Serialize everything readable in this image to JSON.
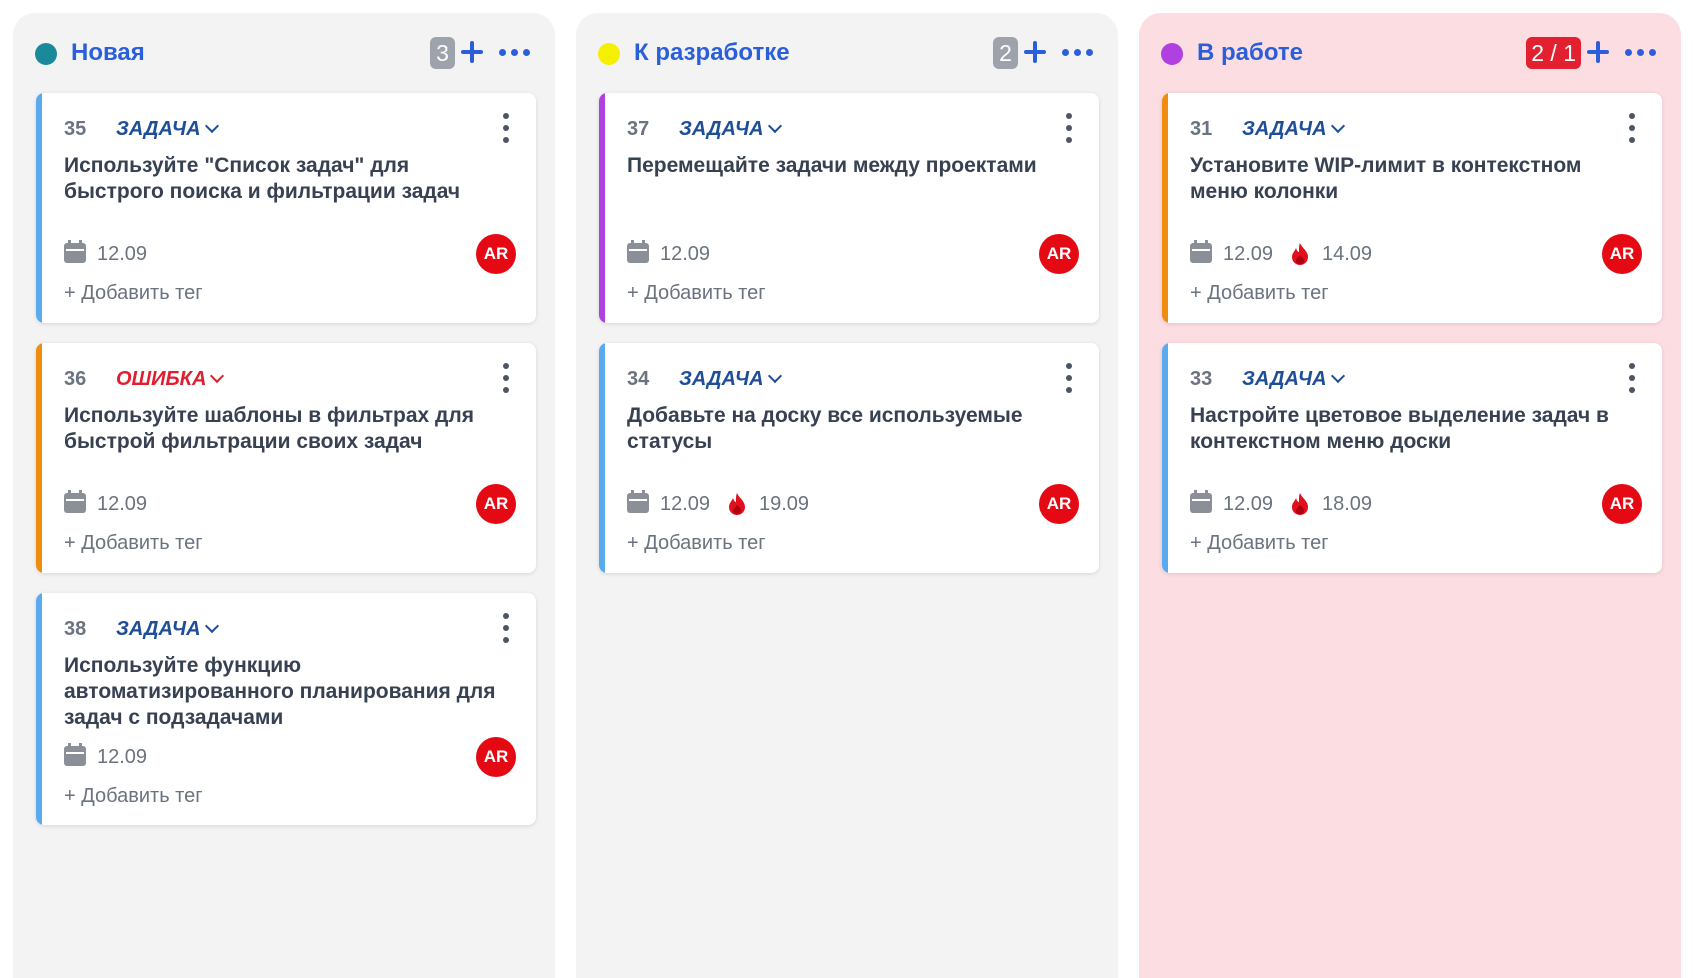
{
  "columns": [
    {
      "title": "Новая",
      "dot_color": "#1a8a9a",
      "count": "3",
      "count_over_limit": false,
      "cards": [
        {
          "number": "35",
          "type": "ЗАДАЧА",
          "type_color": "#1f4e99",
          "stripe_color": "#5aaaf0",
          "title": "Используйте \"Список задач\" для быстрого поиска и фильтрации задач",
          "date": "12.09",
          "deadline": null,
          "assignee": "AR",
          "add_tag": "+ Добавить тег"
        },
        {
          "number": "36",
          "type": "ОШИБКА",
          "type_color": "#e01e2d",
          "stripe_color": "#f08c10",
          "title": "Используйте шаблоны в фильтрах для быстрой фильтрации своих задач",
          "date": "12.09",
          "deadline": null,
          "assignee": "AR",
          "add_tag": "+ Добавить тег"
        },
        {
          "number": "38",
          "type": "ЗАДАЧА",
          "type_color": "#1f4e99",
          "stripe_color": "#5aaaf0",
          "title": "Используйте функцию автоматизированного планирования для задач с подзадачами",
          "date": "12.09",
          "deadline": null,
          "assignee": "AR",
          "add_tag": "+ Добавить тег"
        }
      ]
    },
    {
      "title": "К разработке",
      "dot_color": "#f5f000",
      "count": "2",
      "count_over_limit": false,
      "cards": [
        {
          "number": "37",
          "type": "ЗАДАЧА",
          "type_color": "#1f4e99",
          "stripe_color": "#b040e0",
          "title": "Перемещайте задачи между проектами",
          "date": "12.09",
          "deadline": null,
          "assignee": "AR",
          "add_tag": "+ Добавить тег"
        },
        {
          "number": "34",
          "type": "ЗАДАЧА",
          "type_color": "#1f4e99",
          "stripe_color": "#5aaaf0",
          "title": "Добавьте на доску все используемые статусы",
          "date": "12.09",
          "deadline": "19.09",
          "assignee": "AR",
          "add_tag": "+ Добавить тег"
        }
      ]
    },
    {
      "title": "В работе",
      "dot_color": "#b040e0",
      "count": "2 / 1",
      "count_over_limit": true,
      "cards": [
        {
          "number": "31",
          "type": "ЗАДАЧА",
          "type_color": "#1f4e99",
          "stripe_color": "#f08c10",
          "title": "Установите WIP-лимит в контекстном меню колонки",
          "date": "12.09",
          "deadline": "14.09",
          "assignee": "AR",
          "add_tag": "+ Добавить тег"
        },
        {
          "number": "33",
          "type": "ЗАДАЧА",
          "type_color": "#1f4e99",
          "stripe_color": "#5aaaf0",
          "title": "Настройте цветовое выделение задач в контекстном меню доски",
          "date": "12.09",
          "deadline": "18.09",
          "assignee": "AR",
          "add_tag": "+ Добавить тег"
        }
      ]
    }
  ],
  "icons": {
    "date": "calendar-icon",
    "deadline": "fire-icon",
    "add": "plus-icon",
    "more": "more-horizontal-icon",
    "card_menu": "more-vertical-icon",
    "type_dropdown": "chevron-down-icon"
  }
}
